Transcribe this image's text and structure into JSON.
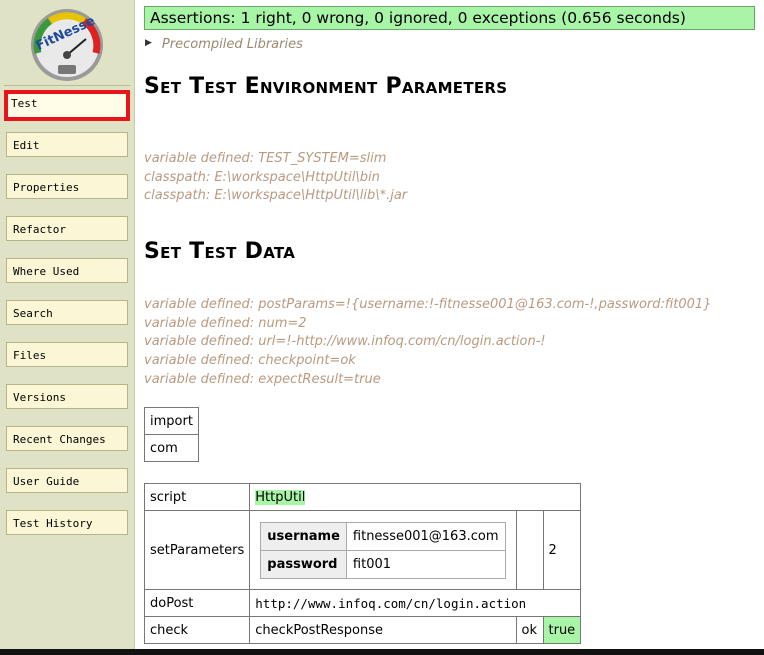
{
  "sidebar": {
    "logo_text": "FitNesse",
    "items": [
      {
        "label": "Test",
        "active": true
      },
      {
        "label": "Edit"
      },
      {
        "label": "Properties"
      },
      {
        "label": "Refactor"
      },
      {
        "label": "Where Used"
      },
      {
        "label": "Search"
      },
      {
        "label": "Files"
      },
      {
        "label": "Versions"
      },
      {
        "label": "Recent Changes"
      },
      {
        "label": "User Guide"
      },
      {
        "label": "Test History"
      }
    ]
  },
  "assertions": {
    "text": "Assertions: 1 right, 0 wrong, 0 ignored, 0 exceptions (0.656 seconds)",
    "status_color": "#a8f5a8"
  },
  "precompiled": {
    "label": "Precompiled Libraries"
  },
  "sections": {
    "env_title": "Set Test Environment Parameters",
    "env_vars": [
      "variable defined: TEST_SYSTEM=slim",
      "classpath: E:\\workspace\\HttpUtil\\bin",
      "classpath: E:\\workspace\\HttpUtil\\lib\\*.jar"
    ],
    "data_title": "Set Test Data",
    "data_vars": [
      "variable defined: postParams=!{username:!-fitnesse001@163.com-!,password:fit001}",
      "variable defined: num=2",
      "variable defined: url=!-http://www.infoq.com/cn/login.action-!",
      "variable defined: checkpoint=ok",
      "variable defined: expectResult=true"
    ]
  },
  "import_table": {
    "rows": [
      "import",
      "com"
    ]
  },
  "script_table": {
    "script_label": "script",
    "script_class": "HttpUtil",
    "set_params_label": "setParameters",
    "params": [
      {
        "key": "username",
        "value": "fitnesse001@163.com"
      },
      {
        "key": "password",
        "value": "fit001"
      }
    ],
    "num_value": "2",
    "dopost_label": "doPost",
    "dopost_url": "http://www.infoq.com/cn/login.action",
    "check_label": "check",
    "check_method": "checkPostResponse",
    "check_value": "ok",
    "check_result": "true"
  }
}
